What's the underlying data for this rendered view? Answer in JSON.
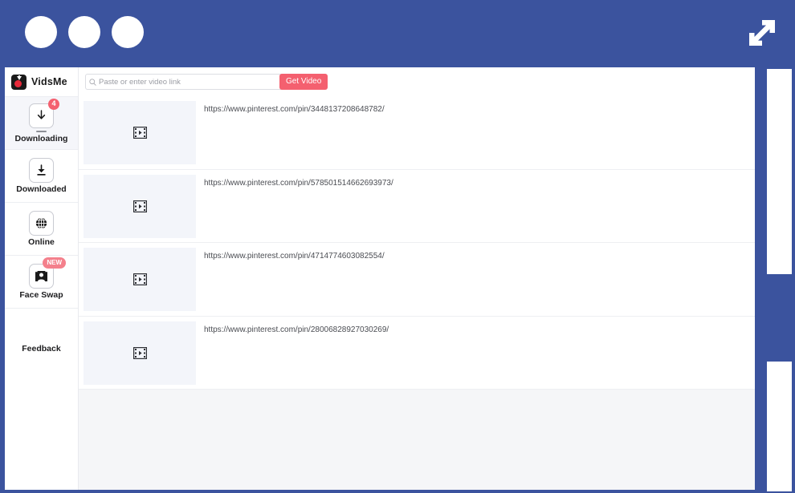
{
  "window": {
    "controls": [
      "window-circle-1",
      "window-circle-2",
      "window-circle-3"
    ],
    "expand_icon": "expand-arrows-icon",
    "accent_blue": "#3b539e"
  },
  "sidebar": {
    "brand": {
      "name": "VidsMe",
      "logo_icon": "vidsme-logo-icon"
    },
    "items": [
      {
        "label": "Downloading",
        "icon": "download-arrow-icon",
        "badge": "4",
        "badge_type": "count",
        "active": true
      },
      {
        "label": "Downloaded",
        "icon": "download-complete-icon",
        "badge": "",
        "badge_type": "none",
        "active": false
      },
      {
        "label": "Online",
        "icon": "globe-icon",
        "badge": "",
        "badge_type": "none",
        "active": false
      },
      {
        "label": "Face Swap",
        "icon": "person-portrait-icon",
        "badge": "NEW",
        "badge_type": "new",
        "active": false
      },
      {
        "label": "Feedback",
        "icon": "",
        "badge": "",
        "badge_type": "none",
        "active": false
      }
    ],
    "badge_color": "#f4606f"
  },
  "toolbar": {
    "search_placeholder": "Paste or enter video link",
    "search_value": "",
    "search_icon": "search-icon",
    "get_video_label": "Get Video",
    "get_video_color": "#f4606f"
  },
  "downloads": {
    "rows": [
      {
        "url": "https://www.pinterest.com/pin/3448137208648782/",
        "thumb_icon": "video-film-icon"
      },
      {
        "url": "https://www.pinterest.com/pin/578501514662693973/",
        "thumb_icon": "video-film-icon"
      },
      {
        "url": "https://www.pinterest.com/pin/4714774603082554/",
        "thumb_icon": "video-film-icon"
      },
      {
        "url": "https://www.pinterest.com/pin/28006828927030269/",
        "thumb_icon": "video-film-icon"
      }
    ]
  }
}
